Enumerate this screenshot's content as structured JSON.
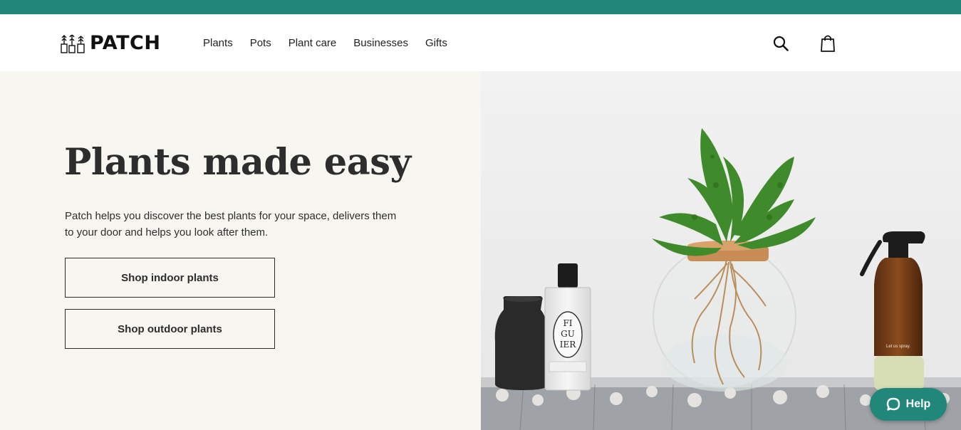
{
  "brand": {
    "name": "PATCH",
    "accent": "#21877a",
    "hero_bg": "#f8f6f0"
  },
  "nav": {
    "items": [
      {
        "label": "Plants"
      },
      {
        "label": "Pots"
      },
      {
        "label": "Plant care"
      },
      {
        "label": "Businesses"
      },
      {
        "label": "Gifts"
      }
    ]
  },
  "header_icons": {
    "search": "search-icon",
    "bag": "shopping-bag-icon"
  },
  "hero": {
    "title": "Plants made easy",
    "description": "Patch helps you discover the best plants for your space, delivers them to your door and helps you look after them.",
    "cta_indoor": "Shop indoor plants",
    "cta_outdoor": "Shop outdoor plants",
    "photo_labels": {
      "candle_line1": "FI",
      "candle_line2": "GU",
      "candle_line3": "IER",
      "spray_label": "Let us spray."
    }
  },
  "help": {
    "label": "Help",
    "icon": "chat-bubble-icon"
  }
}
